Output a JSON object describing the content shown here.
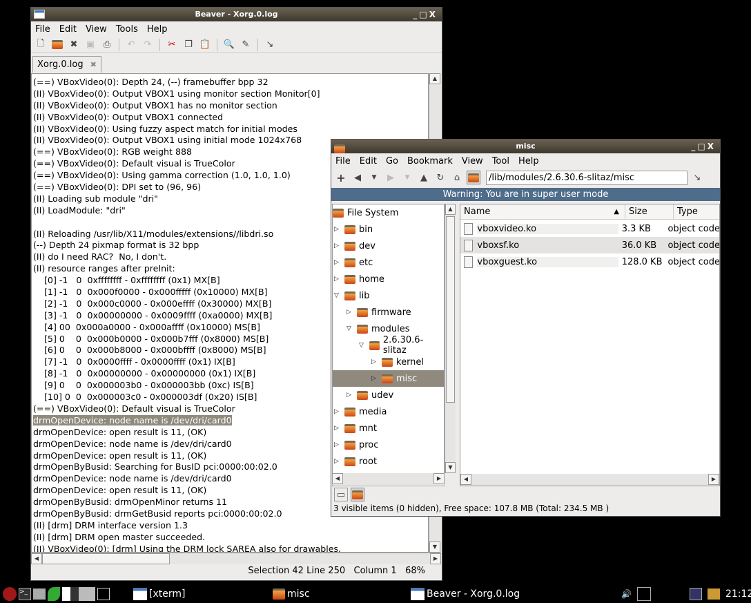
{
  "beaver": {
    "title": "Beaver - Xorg.0.log",
    "menu": [
      "File",
      "Edit",
      "View",
      "Tools",
      "Help"
    ],
    "tab_label": "Xorg.0.log",
    "lines": [
      "(==) VBoxVideo(0): Depth 24, (--) framebuffer bpp 32",
      "(II) VBoxVideo(0): Output VBOX1 using monitor section Monitor[0]",
      "(II) VBoxVideo(0): Output VBOX1 has no monitor section",
      "(II) VBoxVideo(0): Output VBOX1 connected",
      "(II) VBoxVideo(0): Using fuzzy aspect match for initial modes",
      "(II) VBoxVideo(0): Output VBOX1 using initial mode 1024x768",
      "(==) VBoxVideo(0): RGB weight 888",
      "(==) VBoxVideo(0): Default visual is TrueColor",
      "(==) VBoxVideo(0): Using gamma correction (1.0, 1.0, 1.0)",
      "(==) VBoxVideo(0): DPI set to (96, 96)",
      "(II) Loading sub module \"dri\"",
      "(II) LoadModule: \"dri\"",
      "",
      "(II) Reloading /usr/lib/X11/modules/extensions//libdri.so",
      "(--) Depth 24 pixmap format is 32 bpp",
      "(II) do I need RAC?  No, I don't.",
      "(II) resource ranges after preInit:",
      "    [0] -1   0  0xffffffff - 0xffffffff (0x1) MX[B]",
      "    [1] -1   0  0x000f0000 - 0x000fffff (0x10000) MX[B]",
      "    [2] -1   0  0x000c0000 - 0x000effff (0x30000) MX[B]",
      "    [3] -1   0  0x00000000 - 0x0009ffff (0xa0000) MX[B]",
      "    [4] 00  0x000a0000 - 0x000affff (0x10000) MS[B]",
      "    [5] 0    0  0x000b0000 - 0x000b7fff (0x8000) MS[B]",
      "    [6] 0    0  0x000b8000 - 0x000bffff (0x8000) MS[B]",
      "    [7] -1   0  0x0000ffff - 0x0000ffff (0x1) IX[B]",
      "    [8] -1   0  0x00000000 - 0x00000000 (0x1) IX[B]",
      "    [9] 0    0  0x000003b0 - 0x000003bb (0xc) IS[B]",
      "    [10] 0  0  0x000003c0 - 0x000003df (0x20) IS[B]",
      "(==) VBoxVideo(0): Default visual is TrueColor",
      "drmOpenDevice: node name is /dev/dri/card0",
      "drmOpenDevice: open result is 11, (OK)",
      "drmOpenDevice: node name is /dev/dri/card0",
      "drmOpenDevice: open result is 11, (OK)",
      "drmOpenByBusid: Searching for BusID pci:0000:00:02.0",
      "drmOpenDevice: node name is /dev/dri/card0",
      "drmOpenDevice: open result is 11, (OK)",
      "drmOpenByBusid: drmOpenMinor returns 11",
      "drmOpenByBusid: drmGetBusid reports pci:0000:00:02.0",
      "(II) [drm] DRM interface version 1.3",
      "(II) [drm] DRM open master succeeded.",
      "(II) VBoxVideo(0): [drm] Using the DRM lock SAREA also for drawables."
    ],
    "highlighted_line": 29,
    "status": "Selection 42 Line 250   Column 1   68%"
  },
  "misc": {
    "title": "misc",
    "menu": [
      "File",
      "Edit",
      "Go",
      "Bookmark",
      "View",
      "Tool",
      "Help"
    ],
    "path": "/lib/modules/2.6.30.6-slitaz/misc",
    "warning": "Warning: You are in super user mode",
    "warning_color": "#4f6c8a",
    "tree": [
      {
        "label": "File System",
        "depth": 0,
        "exp": ""
      },
      {
        "label": "bin",
        "depth": 0,
        "exp": "closed"
      },
      {
        "label": "dev",
        "depth": 0,
        "exp": "closed"
      },
      {
        "label": "etc",
        "depth": 0,
        "exp": "closed"
      },
      {
        "label": "home",
        "depth": 0,
        "exp": "closed"
      },
      {
        "label": "lib",
        "depth": 0,
        "exp": "open"
      },
      {
        "label": "firmware",
        "depth": 1,
        "exp": "closed"
      },
      {
        "label": "modules",
        "depth": 1,
        "exp": "open"
      },
      {
        "label": "2.6.30.6-slitaz",
        "depth": 2,
        "exp": "open"
      },
      {
        "label": "kernel",
        "depth": 3,
        "exp": "closed"
      },
      {
        "label": "misc",
        "depth": 3,
        "exp": "closed",
        "selected": true
      },
      {
        "label": "udev",
        "depth": 1,
        "exp": "closed"
      },
      {
        "label": "media",
        "depth": 0,
        "exp": "closed"
      },
      {
        "label": "mnt",
        "depth": 0,
        "exp": "closed"
      },
      {
        "label": "proc",
        "depth": 0,
        "exp": "closed"
      },
      {
        "label": "root",
        "depth": 0,
        "exp": "closed"
      }
    ],
    "columns": [
      "Name",
      "Size",
      "Type"
    ],
    "files": [
      {
        "name": "vboxvideo.ko",
        "size": "3.3 KB",
        "type": "object code"
      },
      {
        "name": "vboxsf.ko",
        "size": "36.0 KB",
        "type": "object code"
      },
      {
        "name": "vboxguest.ko",
        "size": "128.0 KB",
        "type": "object code"
      }
    ],
    "status": "3 visible items (0 hidden), Free space: 107.8 MB (Total: 234.5 MB )"
  },
  "taskbar": {
    "tasks": [
      "[xterm]",
      "misc",
      "Beaver - Xorg.0.log"
    ],
    "clock": "21:12"
  }
}
